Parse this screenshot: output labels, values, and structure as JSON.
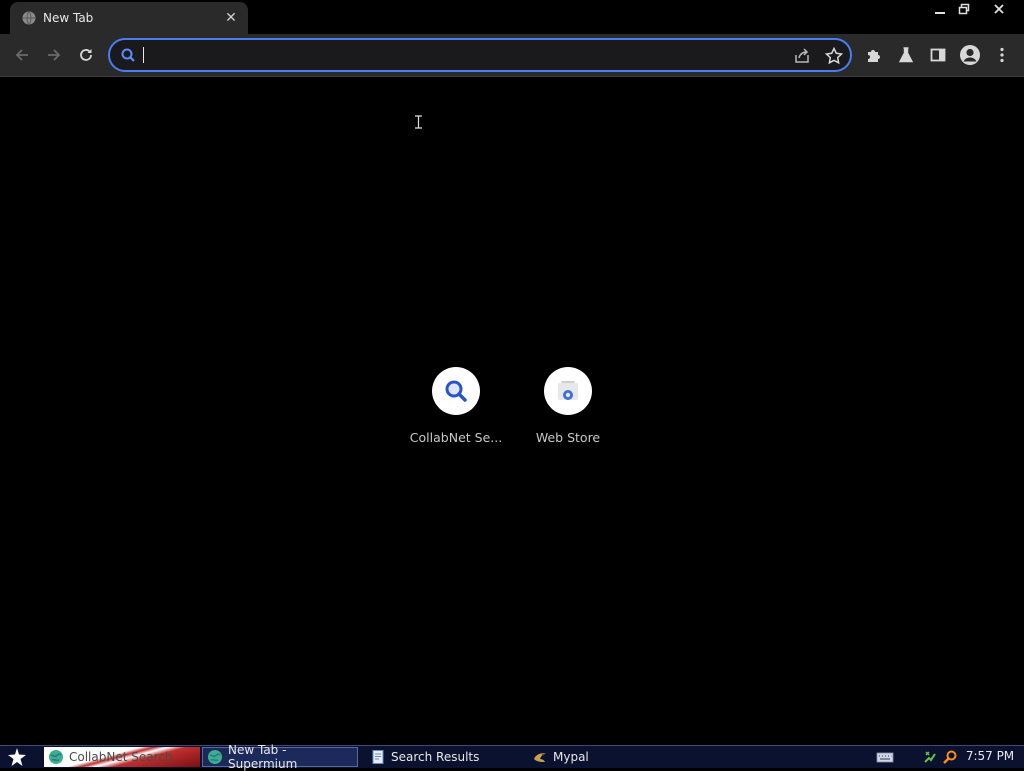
{
  "tab": {
    "title": "New Tab",
    "close_glyph": "✕"
  },
  "window_controls": {
    "minimize": "minimize-icon",
    "maximize": "restore-icon",
    "close": "close-icon"
  },
  "toolbar": {
    "omnibox_value": "",
    "omnibox_placeholder": ""
  },
  "shortcuts": [
    {
      "label": "CollabNet Se...",
      "icon": "search-icon"
    },
    {
      "label": "Web Store",
      "icon": "web-store-icon"
    }
  ],
  "taskbar": {
    "tasks": [
      {
        "label": "CollabNet Search",
        "icon": "globe-icon"
      },
      {
        "label": "New Tab - Supermium",
        "icon": "globe-icon"
      },
      {
        "label": "Search Results",
        "icon": "document-icon"
      },
      {
        "label": "Mypal",
        "icon": "mypal-icon"
      }
    ],
    "clock": "7:57 PM"
  },
  "colors": {
    "accent": "#4a7df2",
    "toolbar_bg": "#2a2a2b",
    "page_bg": "#000000",
    "taskbar_bg": "#0a1230"
  }
}
